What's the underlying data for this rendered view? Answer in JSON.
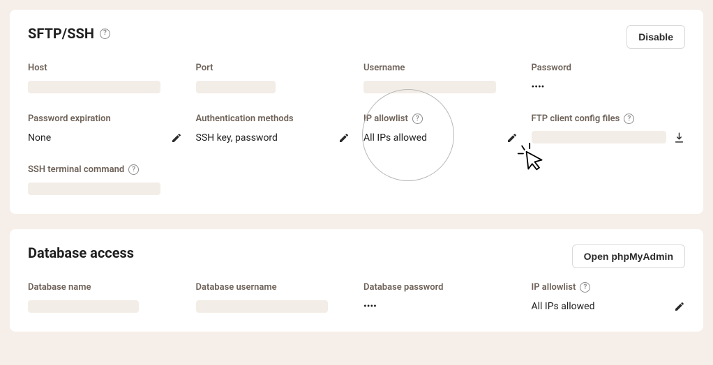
{
  "sftp": {
    "title": "SFTP/SSH",
    "disable_label": "Disable",
    "host_label": "Host",
    "port_label": "Port",
    "username_label": "Username",
    "password_label": "Password",
    "password_value": "••••",
    "pw_exp_label": "Password expiration",
    "pw_exp_value": "None",
    "auth_label": "Authentication methods",
    "auth_value": "SSH key, password",
    "ip_label": "IP allowlist",
    "ip_value": "All IPs allowed",
    "ftp_label": "FTP client config files",
    "ssh_cmd_label": "SSH terminal command"
  },
  "db": {
    "title": "Database access",
    "open_label": "Open phpMyAdmin",
    "dbname_label": "Database name",
    "dbuser_label": "Database username",
    "dbpass_label": "Database password",
    "dbpass_value": "••••",
    "ip_label": "IP allowlist",
    "ip_value": "All IPs allowed"
  }
}
